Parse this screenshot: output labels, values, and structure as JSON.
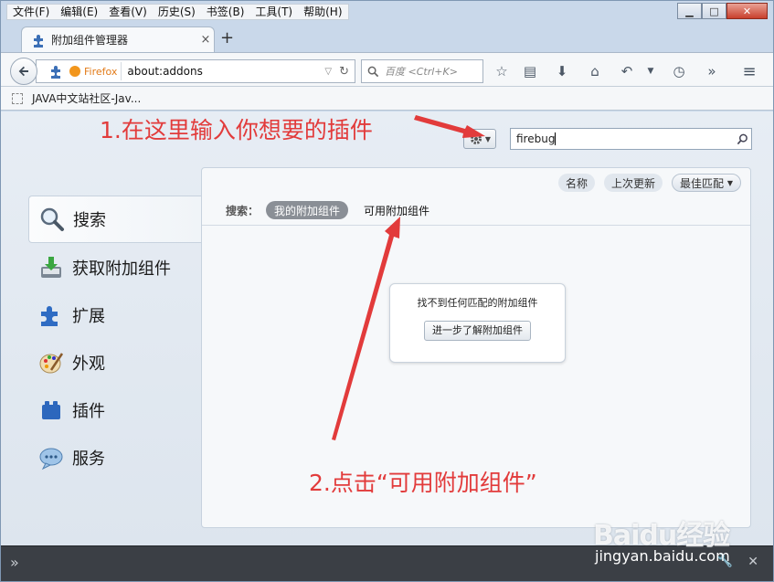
{
  "menu": [
    "文件(F)",
    "编辑(E)",
    "查看(V)",
    "历史(S)",
    "书签(B)",
    "工具(T)",
    "帮助(H)"
  ],
  "tab": {
    "title": "附加组件管理器",
    "close": "×",
    "new": "+"
  },
  "urlbar": {
    "identity": "Firefox",
    "url": "about:addons"
  },
  "searchbar": {
    "placeholder": "百度 <Ctrl+K>"
  },
  "bookmarks": {
    "item": "JAVA中文站社区-Jav..."
  },
  "annotations": {
    "step1": "1.在这里输入你想要的插件",
    "step2": "2.点击“可用附加组件”"
  },
  "addon_search": {
    "value": "firebug"
  },
  "categories": [
    {
      "label": "搜索",
      "icon": "search-icon",
      "selected": true
    },
    {
      "label": "获取附加组件",
      "icon": "get-addons-icon"
    },
    {
      "label": "扩展",
      "icon": "extension-puzzle-icon"
    },
    {
      "label": "外观",
      "icon": "appearance-palette-icon"
    },
    {
      "label": "插件",
      "icon": "plugin-lego-icon"
    },
    {
      "label": "服务",
      "icon": "services-chat-icon"
    }
  ],
  "sort": {
    "name": "名称",
    "updated": "上次更新",
    "best": "最佳匹配"
  },
  "scope": {
    "label": "搜索：",
    "mine": "我的附加组件",
    "available": "可用附加组件"
  },
  "message": {
    "text": "找不到任何匹配的附加组件",
    "button": "进一步了解附加组件"
  },
  "watermark": {
    "logo": "Baidu经验",
    "url": "jingyan.baidu.com"
  },
  "colors": {
    "annotation": "#e23b3b",
    "accent": "#f2961d"
  }
}
